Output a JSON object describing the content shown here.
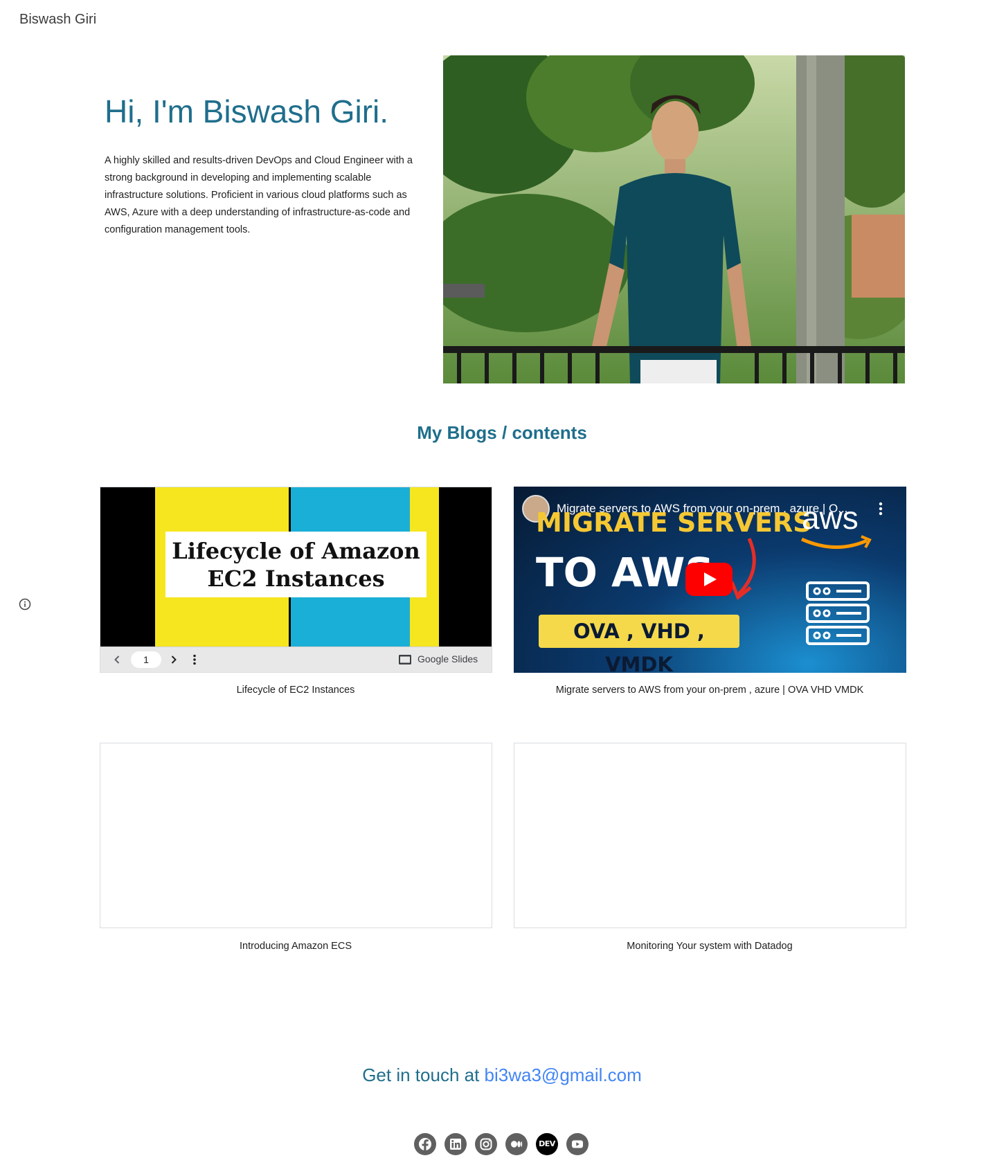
{
  "header": {
    "site_title": "Biswash Giri"
  },
  "hero": {
    "heading": "Hi, I'm Biswash Giri.",
    "description": "A highly skilled and results-driven DevOps and Cloud Engineer with a strong background in developing and implementing scalable infrastructure solutions. Proficient in various cloud platforms such as AWS, Azure with a deep understanding of infrastructure-as-code and configuration management tools."
  },
  "blogs": {
    "section_title": "My Blogs / contents",
    "cards": [
      {
        "caption": "Lifecycle of EC2 Instances",
        "slide_title_line1": "Lifecycle of Amazon",
        "slide_title_line2": "EC2 Instances",
        "page_number": "1",
        "provider": "Google Slides"
      },
      {
        "caption": "Migrate servers to AWS from your on-prem , azure | OVA VHD VMDK",
        "video_title": "Migrate servers to AWS from your on-prem , azure | O...",
        "thumb_line1": "MIGRATE SERVERS",
        "thumb_line2": "TO AWS",
        "thumb_badge": "OVA , VHD , VMDK",
        "thumb_logo": "aws"
      },
      {
        "caption": "Introducing Amazon ECS"
      },
      {
        "caption": "Monitoring Your system with Datadog"
      }
    ]
  },
  "contact": {
    "prefix": "Get in touch at ",
    "email": "bi3wa3@gmail.com"
  },
  "social": {
    "dev_label": "DEV",
    "icons": [
      "facebook-icon",
      "linkedin-icon",
      "instagram-icon",
      "medium-icon",
      "dev-icon",
      "youtube-icon"
    ]
  },
  "colors": {
    "heading": "#1f6e8c",
    "link": "#4285f4",
    "social_bg": "#606060"
  }
}
